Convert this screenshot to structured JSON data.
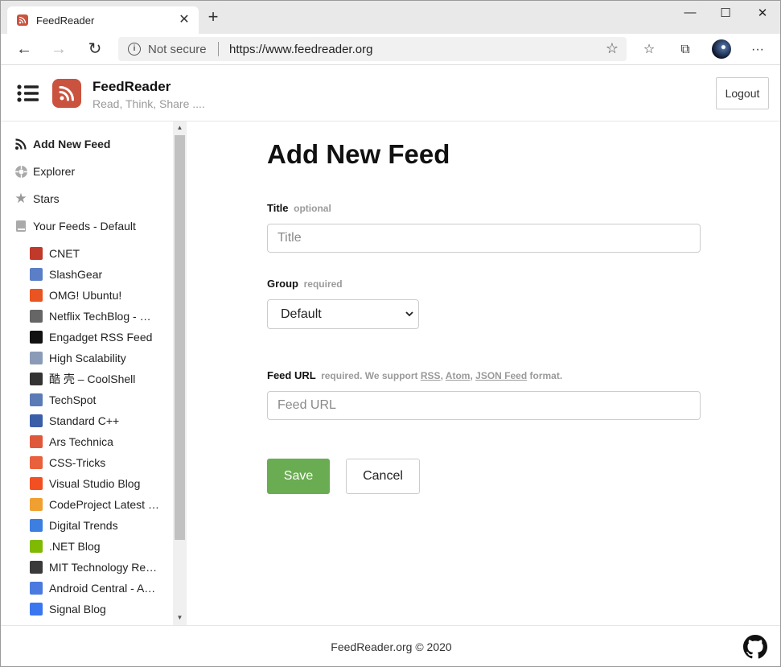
{
  "browser": {
    "tab_title": "FeedReader",
    "security": "Not secure",
    "url": "https://www.feedreader.org"
  },
  "header": {
    "brand": "FeedReader",
    "tagline": "Read, Think, Share ....",
    "logout_label": "Logout"
  },
  "sidebar": {
    "nav": [
      {
        "label": "Add New Feed",
        "icon": "rss-icon"
      },
      {
        "label": "Explorer",
        "icon": "explorer-icon"
      },
      {
        "label": "Stars",
        "icon": "star-icon"
      },
      {
        "label": "Your Feeds - Default",
        "icon": "book-icon"
      }
    ],
    "feeds": [
      {
        "label": "CNET",
        "color": "#c0392b"
      },
      {
        "label": "SlashGear",
        "color": "#5b7fc7"
      },
      {
        "label": "OMG! Ubuntu!",
        "color": "#e95420"
      },
      {
        "label": "Netflix TechBlog - …",
        "color": "#666666"
      },
      {
        "label": "Engadget RSS Feed",
        "color": "#111111"
      },
      {
        "label": "High Scalability",
        "color": "#8a9bb8"
      },
      {
        "label": "酷 壳 – CoolShell",
        "color": "#333333"
      },
      {
        "label": "TechSpot",
        "color": "#5a7bb5"
      },
      {
        "label": "Standard C++",
        "color": "#3b5ea8"
      },
      {
        "label": "Ars Technica",
        "color": "#e0583a"
      },
      {
        "label": "CSS-Tricks",
        "color": "#e8603c"
      },
      {
        "label": "Visual Studio Blog",
        "color": "#f25022"
      },
      {
        "label": "CodeProject Latest …",
        "color": "#f0a030"
      },
      {
        "label": "Digital Trends",
        "color": "#3c7fe0"
      },
      {
        "label": ".NET Blog",
        "color": "#7fba00"
      },
      {
        "label": "MIT Technology Re…",
        "color": "#3a3a3a"
      },
      {
        "label": "Android Central - A…",
        "color": "#4a7ae0"
      },
      {
        "label": "Signal Blog",
        "color": "#3a76f0"
      }
    ]
  },
  "main": {
    "title": "Add New Feed",
    "title_field": {
      "label": "Title",
      "hint": "optional",
      "placeholder": "Title"
    },
    "group_field": {
      "label": "Group",
      "hint": "required",
      "value": "Default"
    },
    "url_field": {
      "label": "Feed URL",
      "hint_prefix": "required. We support",
      "link_rss": "RSS",
      "link_atom": "Atom",
      "link_json": "JSON Feed",
      "hint_suffix": "format.",
      "placeholder": "Feed URL"
    },
    "save_label": "Save",
    "cancel_label": "Cancel"
  },
  "footer": {
    "copyright": "FeedReader.org © 2020"
  }
}
